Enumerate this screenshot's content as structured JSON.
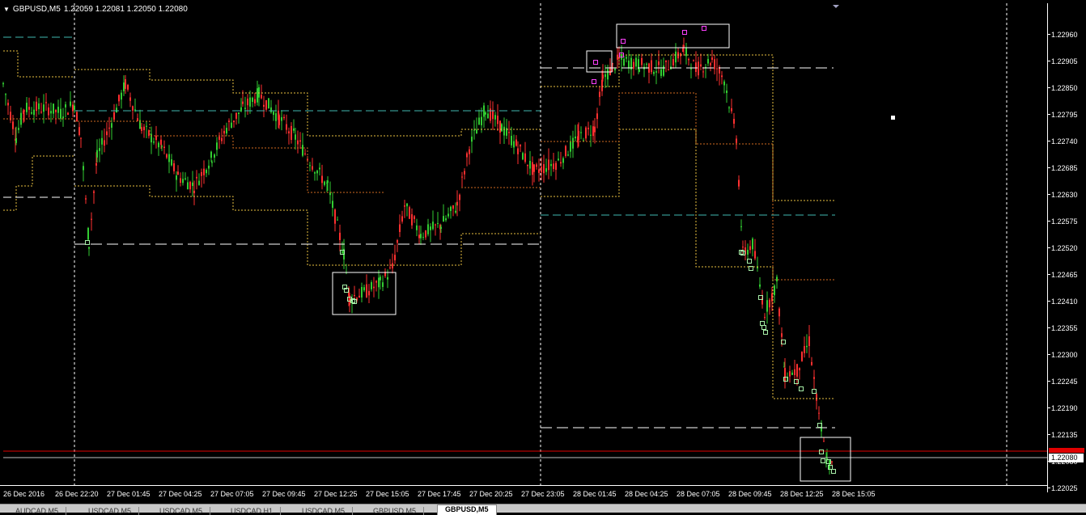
{
  "header": {
    "symbol": "GBPUSD,M5",
    "ohlc": "1.22059 1.22081 1.22050 1.22080"
  },
  "price_axis": {
    "labels": [
      "1.22960",
      "1.22905",
      "1.22850",
      "1.22795",
      "1.22740",
      "1.22685",
      "1.22630",
      "1.22575",
      "1.22520",
      "1.22465",
      "1.22410",
      "1.22355",
      "1.22300",
      "1.22245",
      "1.22190",
      "1.22135",
      "1.22080",
      "1.22025"
    ],
    "current_price": "1.22080"
  },
  "time_axis": {
    "labels": [
      "26 Dec 2016",
      "26 Dec 22:20",
      "27 Dec 01:45",
      "27 Dec 04:25",
      "27 Dec 07:05",
      "27 Dec 09:45",
      "27 Dec 12:25",
      "27 Dec 15:05",
      "27 Dec 17:45",
      "27 Dec 20:25",
      "27 Dec 23:05",
      "28 Dec 01:45",
      "28 Dec 04:25",
      "28 Dec 07:05",
      "28 Dec 09:45",
      "28 Dec 12:25",
      "28 Dec 15:05"
    ]
  },
  "tabs": [
    {
      "label": "AUDCAD,M5",
      "active": false
    },
    {
      "label": "USDCAD,M5",
      "active": false
    },
    {
      "label": "USDCAD,M5",
      "active": false
    },
    {
      "label": "USDCAD,H1",
      "active": false
    },
    {
      "label": "USDCAD,M5",
      "active": false
    },
    {
      "label": "GBPUSD,M5",
      "active": false
    },
    {
      "label": "GBPUSD,M5",
      "active": true
    }
  ],
  "colors": {
    "background": "#000000",
    "bull": "#32cd32",
    "bear": "#ff3030",
    "level_orange": "#e8c040",
    "level_teal": "#3fb8b0",
    "level_white": "#ffffff",
    "current_line": "#c0c0c0",
    "red_line": "#e00000",
    "marker_green": "#a8f0a8",
    "marker_magenta": "#ff40ff"
  }
}
